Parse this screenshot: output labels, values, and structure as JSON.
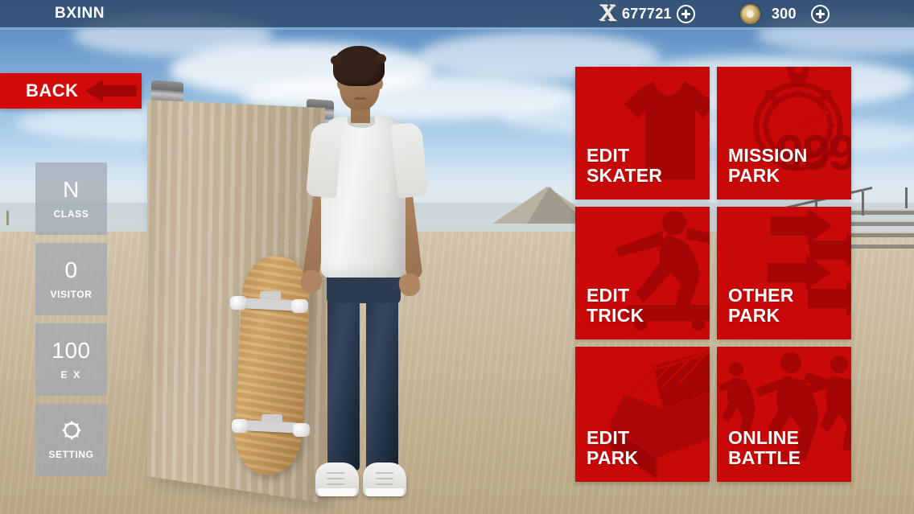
{
  "app": {
    "title": "BXINN"
  },
  "topbar": {
    "currencies": [
      {
        "icon": "x-coin-icon",
        "value": "677721",
        "add_label": "+"
      },
      {
        "icon": "gold-coin-icon",
        "value": "300",
        "add_label": "+"
      }
    ]
  },
  "back_button": {
    "label": "BACK",
    "icon": "left-arrow-icon"
  },
  "stats": [
    {
      "name": "class",
      "value": "N",
      "label": "CLASS",
      "wide": false
    },
    {
      "name": "visitor",
      "value": "0",
      "label": "VISITOR",
      "wide": false
    },
    {
      "name": "ex",
      "value": "100",
      "label": "E X",
      "wide": true
    },
    {
      "name": "setting",
      "value": "",
      "label": "SETTING",
      "icon": "gear-icon"
    }
  ],
  "menu": {
    "tiles": [
      {
        "name": "edit-skater",
        "line1": "EDIT",
        "line2": "SKATER",
        "art": "tshirt-icon"
      },
      {
        "name": "mission-park",
        "line1": "MISSION",
        "line2": "PARK",
        "art": "stopwatch-icon",
        "badge": "999"
      },
      {
        "name": "edit-trick",
        "line1": "EDIT",
        "line2": "TRICK",
        "art": "skater-trick-icon"
      },
      {
        "name": "other-park",
        "line1": "OTHER",
        "line2": "PARK",
        "art": "arrows-right-icon"
      },
      {
        "name": "edit-park",
        "line1": "EDIT",
        "line2": "PARK",
        "art": "stairs-ramp-icon"
      },
      {
        "name": "online-battle",
        "line1": "ONLINE",
        "line2": "BATTLE",
        "art": "skaters-group-icon"
      }
    ]
  },
  "colors": {
    "tile_red": "#c90808",
    "tile_art_red": "#a00505",
    "back_red": "#d40a0a",
    "topbar_blue": "#304869",
    "stat_gray": "#a0a8b2"
  },
  "scene": {
    "description": "3d-skatepark-character-preview"
  }
}
